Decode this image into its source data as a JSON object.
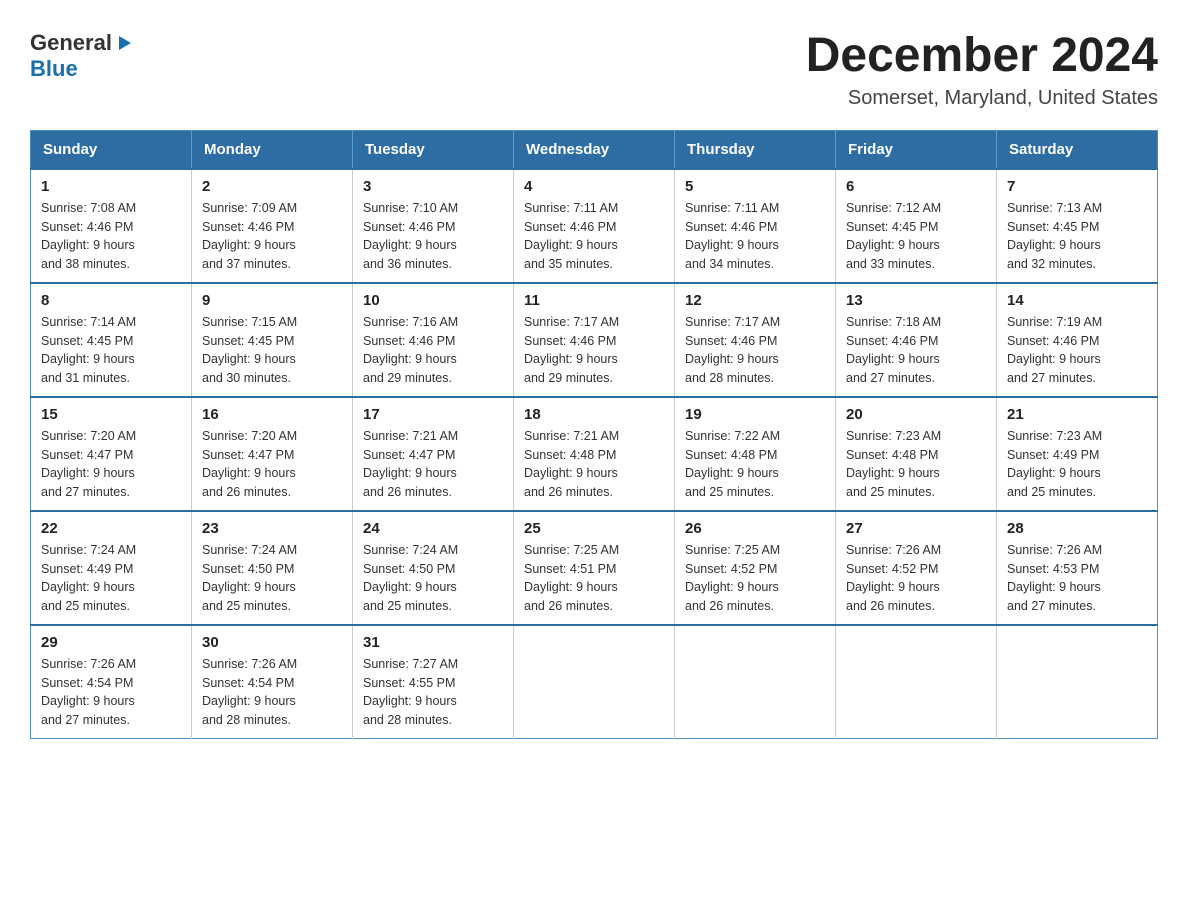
{
  "logo": {
    "general": "General",
    "arrow": "▶",
    "blue": "Blue"
  },
  "title": {
    "month_year": "December 2024",
    "location": "Somerset, Maryland, United States"
  },
  "days_of_week": [
    "Sunday",
    "Monday",
    "Tuesday",
    "Wednesday",
    "Thursday",
    "Friday",
    "Saturday"
  ],
  "weeks": [
    [
      {
        "day": "1",
        "sunrise": "7:08 AM",
        "sunset": "4:46 PM",
        "daylight": "9 hours and 38 minutes."
      },
      {
        "day": "2",
        "sunrise": "7:09 AM",
        "sunset": "4:46 PM",
        "daylight": "9 hours and 37 minutes."
      },
      {
        "day": "3",
        "sunrise": "7:10 AM",
        "sunset": "4:46 PM",
        "daylight": "9 hours and 36 minutes."
      },
      {
        "day": "4",
        "sunrise": "7:11 AM",
        "sunset": "4:46 PM",
        "daylight": "9 hours and 35 minutes."
      },
      {
        "day": "5",
        "sunrise": "7:11 AM",
        "sunset": "4:46 PM",
        "daylight": "9 hours and 34 minutes."
      },
      {
        "day": "6",
        "sunrise": "7:12 AM",
        "sunset": "4:45 PM",
        "daylight": "9 hours and 33 minutes."
      },
      {
        "day": "7",
        "sunrise": "7:13 AM",
        "sunset": "4:45 PM",
        "daylight": "9 hours and 32 minutes."
      }
    ],
    [
      {
        "day": "8",
        "sunrise": "7:14 AM",
        "sunset": "4:45 PM",
        "daylight": "9 hours and 31 minutes."
      },
      {
        "day": "9",
        "sunrise": "7:15 AM",
        "sunset": "4:45 PM",
        "daylight": "9 hours and 30 minutes."
      },
      {
        "day": "10",
        "sunrise": "7:16 AM",
        "sunset": "4:46 PM",
        "daylight": "9 hours and 29 minutes."
      },
      {
        "day": "11",
        "sunrise": "7:17 AM",
        "sunset": "4:46 PM",
        "daylight": "9 hours and 29 minutes."
      },
      {
        "day": "12",
        "sunrise": "7:17 AM",
        "sunset": "4:46 PM",
        "daylight": "9 hours and 28 minutes."
      },
      {
        "day": "13",
        "sunrise": "7:18 AM",
        "sunset": "4:46 PM",
        "daylight": "9 hours and 27 minutes."
      },
      {
        "day": "14",
        "sunrise": "7:19 AM",
        "sunset": "4:46 PM",
        "daylight": "9 hours and 27 minutes."
      }
    ],
    [
      {
        "day": "15",
        "sunrise": "7:20 AM",
        "sunset": "4:47 PM",
        "daylight": "9 hours and 27 minutes."
      },
      {
        "day": "16",
        "sunrise": "7:20 AM",
        "sunset": "4:47 PM",
        "daylight": "9 hours and 26 minutes."
      },
      {
        "day": "17",
        "sunrise": "7:21 AM",
        "sunset": "4:47 PM",
        "daylight": "9 hours and 26 minutes."
      },
      {
        "day": "18",
        "sunrise": "7:21 AM",
        "sunset": "4:48 PM",
        "daylight": "9 hours and 26 minutes."
      },
      {
        "day": "19",
        "sunrise": "7:22 AM",
        "sunset": "4:48 PM",
        "daylight": "9 hours and 25 minutes."
      },
      {
        "day": "20",
        "sunrise": "7:23 AM",
        "sunset": "4:48 PM",
        "daylight": "9 hours and 25 minutes."
      },
      {
        "day": "21",
        "sunrise": "7:23 AM",
        "sunset": "4:49 PM",
        "daylight": "9 hours and 25 minutes."
      }
    ],
    [
      {
        "day": "22",
        "sunrise": "7:24 AM",
        "sunset": "4:49 PM",
        "daylight": "9 hours and 25 minutes."
      },
      {
        "day": "23",
        "sunrise": "7:24 AM",
        "sunset": "4:50 PM",
        "daylight": "9 hours and 25 minutes."
      },
      {
        "day": "24",
        "sunrise": "7:24 AM",
        "sunset": "4:50 PM",
        "daylight": "9 hours and 25 minutes."
      },
      {
        "day": "25",
        "sunrise": "7:25 AM",
        "sunset": "4:51 PM",
        "daylight": "9 hours and 26 minutes."
      },
      {
        "day": "26",
        "sunrise": "7:25 AM",
        "sunset": "4:52 PM",
        "daylight": "9 hours and 26 minutes."
      },
      {
        "day": "27",
        "sunrise": "7:26 AM",
        "sunset": "4:52 PM",
        "daylight": "9 hours and 26 minutes."
      },
      {
        "day": "28",
        "sunrise": "7:26 AM",
        "sunset": "4:53 PM",
        "daylight": "9 hours and 27 minutes."
      }
    ],
    [
      {
        "day": "29",
        "sunrise": "7:26 AM",
        "sunset": "4:54 PM",
        "daylight": "9 hours and 27 minutes."
      },
      {
        "day": "30",
        "sunrise": "7:26 AM",
        "sunset": "4:54 PM",
        "daylight": "9 hours and 28 minutes."
      },
      {
        "day": "31",
        "sunrise": "7:27 AM",
        "sunset": "4:55 PM",
        "daylight": "9 hours and 28 minutes."
      },
      null,
      null,
      null,
      null
    ]
  ],
  "labels": {
    "sunrise": "Sunrise:",
    "sunset": "Sunset:",
    "daylight": "Daylight:"
  }
}
